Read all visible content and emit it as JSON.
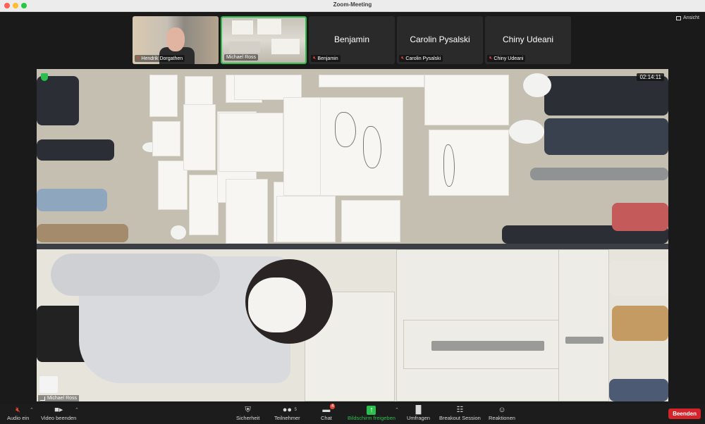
{
  "window": {
    "title": "Zoom-Meeting"
  },
  "view_button": {
    "label": "Ansicht",
    "icon": "grid-view-icon"
  },
  "participants": [
    {
      "name": "Hendrik Dorgathen",
      "video": true,
      "muted": true
    },
    {
      "name": "Michael Ross",
      "video": true,
      "muted": false,
      "active_speaker": true
    },
    {
      "name": "Benjamin",
      "video": false,
      "muted": true
    },
    {
      "name": "Carolin Pysalski",
      "video": false,
      "muted": true
    },
    {
      "name": "Chiny Udeani",
      "video": false,
      "muted": true
    }
  ],
  "main_video": {
    "speaker_name": "Michael Ross",
    "timer": "02:14:11",
    "encryption_icon": "shield-check-icon"
  },
  "toolbar": {
    "audio": {
      "label": "Audio ein",
      "icon": "mic-muted-icon"
    },
    "video": {
      "label": "Video beenden",
      "icon": "camera-icon"
    },
    "security": {
      "label": "Sicherheit",
      "icon": "shield-icon"
    },
    "participants": {
      "label": "Teilnehmer",
      "icon": "people-icon",
      "count": "5"
    },
    "chat": {
      "label": "Chat",
      "icon": "chat-bubble-icon",
      "badge": "4"
    },
    "share": {
      "label": "Bildschirm freigeben",
      "icon": "share-screen-icon"
    },
    "polls": {
      "label": "Umfragen",
      "icon": "bar-chart-icon"
    },
    "breakout": {
      "label": "Breakout Session",
      "icon": "breakout-grid-icon"
    },
    "reactions": {
      "label": "Reaktionen",
      "icon": "emoji-plus-icon"
    },
    "end": {
      "label": "Beenden"
    }
  },
  "colors": {
    "accent_green": "#2dbf4d",
    "muted_red": "#e5483b",
    "end_red": "#d4242b",
    "background": "#1a1a1a"
  }
}
